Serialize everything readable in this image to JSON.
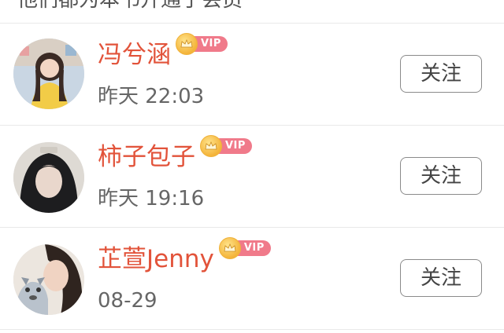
{
  "header": {
    "partial_text": "他们都为本书开通了会员"
  },
  "users": [
    {
      "name": "冯兮涵",
      "vip_label": "VIP",
      "time": "昨天 22:03",
      "follow_label": "关注",
      "avatar": "girl-yellow-sweater-avatar"
    },
    {
      "name": "柿子包子",
      "vip_label": "VIP",
      "time": "昨天 19:16",
      "follow_label": "关注",
      "avatar": "girl-black-hood-avatar"
    },
    {
      "name": "芷萱Jenny",
      "vip_label": "VIP",
      "time": "08-29",
      "follow_label": "关注",
      "avatar": "girl-with-plush-husky-avatar"
    }
  ],
  "colors": {
    "name": "#e2533a",
    "vip_tag": "#f07a8a",
    "crown": "#f4b43a",
    "divider": "#e9e9e9"
  }
}
